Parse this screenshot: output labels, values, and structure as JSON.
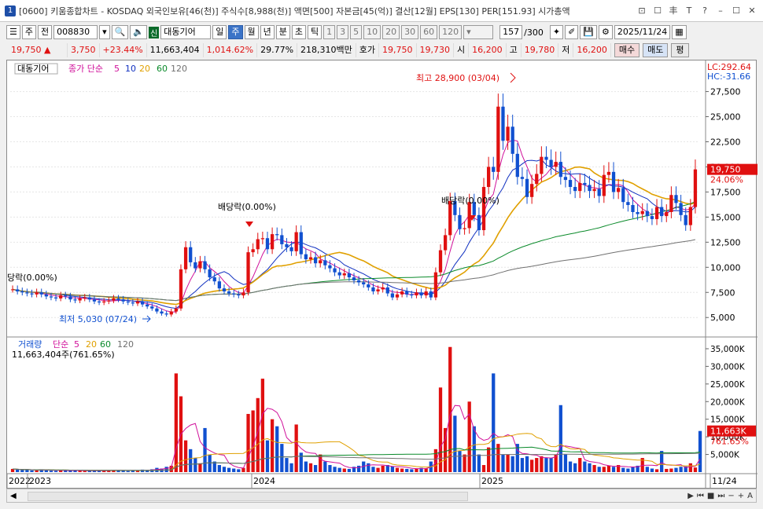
{
  "window": {
    "number": "1",
    "title": "[0600] 키움종합차트 - KOSDAQ 외국인보유[46(천)] 주식수[8,988(천)] 액면[500] 자본금[45(억)] 결산[12월] EPS[130] PER[151.93] 시가총액",
    "buttons": [
      "⊡",
      "☐",
      "丰",
      "T",
      "?",
      "–",
      "☐",
      "✕"
    ]
  },
  "toolbar": {
    "items": [
      "☰",
      "주",
      "전"
    ],
    "code": "008830",
    "name_badge": "신",
    "name": "대동기어",
    "periods": [
      "일",
      "주",
      "월",
      "년",
      "분",
      "초",
      "틱"
    ],
    "period_selected": "주",
    "intervals": [
      "1",
      "3",
      "5",
      "10",
      "20",
      "30",
      "60",
      "120"
    ],
    "count": "157",
    "count_max": "/300",
    "date": "2025/11/24"
  },
  "quote": {
    "price": "19,750",
    "arrow": "▲",
    "change": "3,750",
    "pct": "+23.44%",
    "volume": "11,663,404",
    "vol_pct": "1,014.62%",
    "turnover": "29.77%",
    "amount": "218,310백만",
    "hoga_label": "호가",
    "ask": "19,750",
    "bid": "19,730",
    "open_label": "시",
    "open": "16,200",
    "high_label": "고",
    "high": "19,780",
    "low_label": "저",
    "low": "16,200",
    "buy": "매수",
    "sell": "매도",
    "eval": "평"
  },
  "chart": {
    "name_tag": "대동기어",
    "ma_label": "종가 단순",
    "ma_periods": [
      "5",
      "10",
      "20",
      "60",
      "120"
    ],
    "ma_colors": [
      "#d0109a",
      "#1030c0",
      "#e0a000",
      "#0a8a2a",
      "#707070"
    ],
    "lc": "LC:292.64",
    "hc": "HC:-31.66",
    "price_axis": [
      "27,500",
      "25,000",
      "22,500",
      "20,000",
      "17,500",
      "15,000",
      "12,500",
      "10,000",
      "7,500",
      "5,000"
    ],
    "high_annot": "최고 28,900 (03/04)",
    "low_annot": "최저 5,030 (07/24)",
    "div1": "배당락(0.00%)",
    "div2": "배당락(0.00%)",
    "div_left": "당락(0.00%)",
    "last_price": "19,750",
    "last_pct": "24.06%",
    "vol_title": "거래량",
    "vol_ma_label": "단순",
    "vol_ma_periods": [
      "5",
      "20",
      "60",
      "120"
    ],
    "vol_last": "11,663,404주(761.65%)",
    "vol_axis": [
      "35,000K",
      "30,000K",
      "25,000K",
      "20,000K",
      "15,000K",
      "10,000K",
      "5,000K"
    ],
    "vol_last_tag": "11,663K",
    "vol_last_pct": "761.65%",
    "dates": [
      "2022",
      "2023",
      "2024",
      "2025",
      "11/24"
    ]
  },
  "chart_data": {
    "type": "candlestick",
    "period": "weekly",
    "price_ylim": [
      4000,
      29500
    ],
    "vol_ylim": [
      0,
      37000
    ],
    "closes": [
      7800,
      7600,
      7500,
      7400,
      7300,
      7500,
      7300,
      7100,
      7000,
      6900,
      7200,
      7100,
      6800,
      6700,
      6900,
      7000,
      6800,
      6600,
      6500,
      6600,
      6700,
      6900,
      6800,
      6600,
      6500,
      6400,
      6600,
      6300,
      6100,
      5900,
      5600,
      5400,
      5300,
      5600,
      5900,
      9800,
      12000,
      10500,
      9900,
      10600,
      9800,
      9000,
      8600,
      7900,
      7600,
      7400,
      7300,
      7200,
      7500,
      11500,
      11800,
      12800,
      12900,
      11800,
      13300,
      13200,
      12300,
      12000,
      11600,
      13500,
      11300,
      10800,
      11000,
      10400,
      10700,
      10200,
      9900,
      9500,
      9200,
      9400,
      9000,
      8700,
      8500,
      8300,
      8000,
      7600,
      7800,
      8000,
      7400,
      7000,
      7300,
      7600,
      7300,
      7200,
      7500,
      7200,
      7600,
      7000,
      9500,
      11700,
      13200,
      16600,
      15200,
      13800,
      13900,
      16500,
      15200,
      13700,
      18000,
      20000,
      19500,
      26000,
      22600,
      24000,
      21300,
      19000,
      18800,
      17000,
      18300,
      19300,
      21000,
      20700,
      20000,
      20500,
      19000,
      18700,
      18000,
      17600,
      18400,
      18200,
      17600,
      17800,
      17100,
      19200,
      19500,
      17500,
      17900,
      16500,
      16200,
      15500,
      15300,
      15600,
      15100,
      14800,
      16000,
      15100,
      15500,
      17200,
      16400,
      15200,
      14200,
      16000,
      19750
    ],
    "volumes_k": [
      900,
      700,
      600,
      650,
      500,
      450,
      800,
      500,
      400,
      350,
      600,
      500,
      400,
      450,
      400,
      300,
      350,
      400,
      500,
      450,
      350,
      600,
      500,
      400,
      300,
      500,
      400,
      700,
      600,
      800,
      1200,
      1000,
      1500,
      1800,
      28000,
      21500,
      9000,
      6500,
      4000,
      2500,
      12500,
      5000,
      3000,
      2000,
      1500,
      1200,
      1000,
      800,
      1200,
      16500,
      17500,
      21000,
      26500,
      9000,
      15000,
      13000,
      8000,
      4000,
      2500,
      13500,
      5500,
      3000,
      2500,
      2000,
      5000,
      3000,
      2000,
      1500,
      1200,
      1000,
      900,
      1500,
      1800,
      3000,
      2500,
      1500,
      1200,
      1800,
      2000,
      1600,
      1200,
      1000,
      900,
      800,
      1000,
      1200,
      1100,
      3000,
      6500,
      24000,
      12500,
      35500,
      16000,
      6000,
      5000,
      20000,
      13000,
      5000,
      2000,
      7000,
      28000,
      8000,
      5000,
      5000,
      4500,
      8000,
      4000,
      4500,
      3500,
      4000,
      4500,
      4000,
      4000,
      5000,
      19000,
      5000,
      3000,
      2500,
      4000,
      3000,
      2500,
      2000,
      1500,
      1500,
      1800,
      1500,
      2000,
      1200,
      1000,
      1500,
      1800,
      4000,
      1500,
      1000,
      800,
      6000,
      900,
      1000,
      1200,
      1500,
      1600,
      2500,
      1300,
      11663
    ]
  }
}
